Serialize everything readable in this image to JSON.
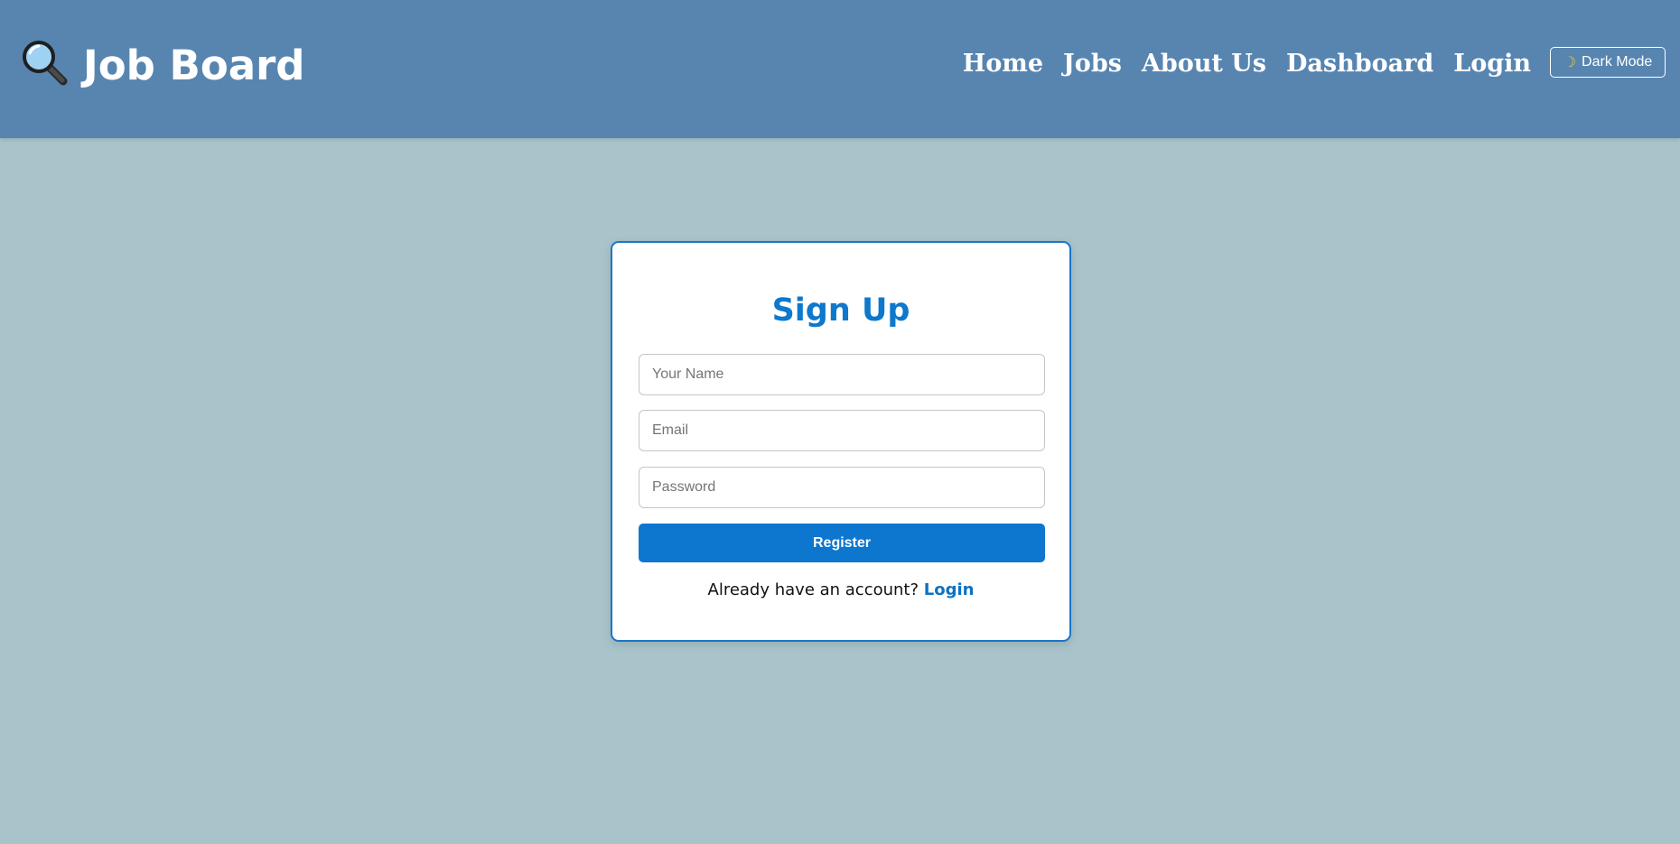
{
  "header": {
    "brand_icon": "magnifying-glass-icon",
    "brand_title": "Job Board",
    "nav": [
      "Home",
      "Jobs",
      "About Us",
      "Dashboard",
      "Login"
    ],
    "dark_mode_icon": "moon-icon",
    "dark_mode_label": "Dark Mode"
  },
  "form": {
    "title": "Sign Up",
    "name_placeholder": "Your Name",
    "email_placeholder": "Email",
    "password_placeholder": "Password",
    "name_value": "",
    "email_value": "",
    "password_value": "",
    "register_label": "Register",
    "login_prompt": "Already have an account?",
    "login_link": "Login"
  },
  "colors": {
    "header_bg": "#5785b0",
    "page_bg": "#a8c4ca",
    "accent": "#0d76cf",
    "card_border": "#1a75c9"
  }
}
